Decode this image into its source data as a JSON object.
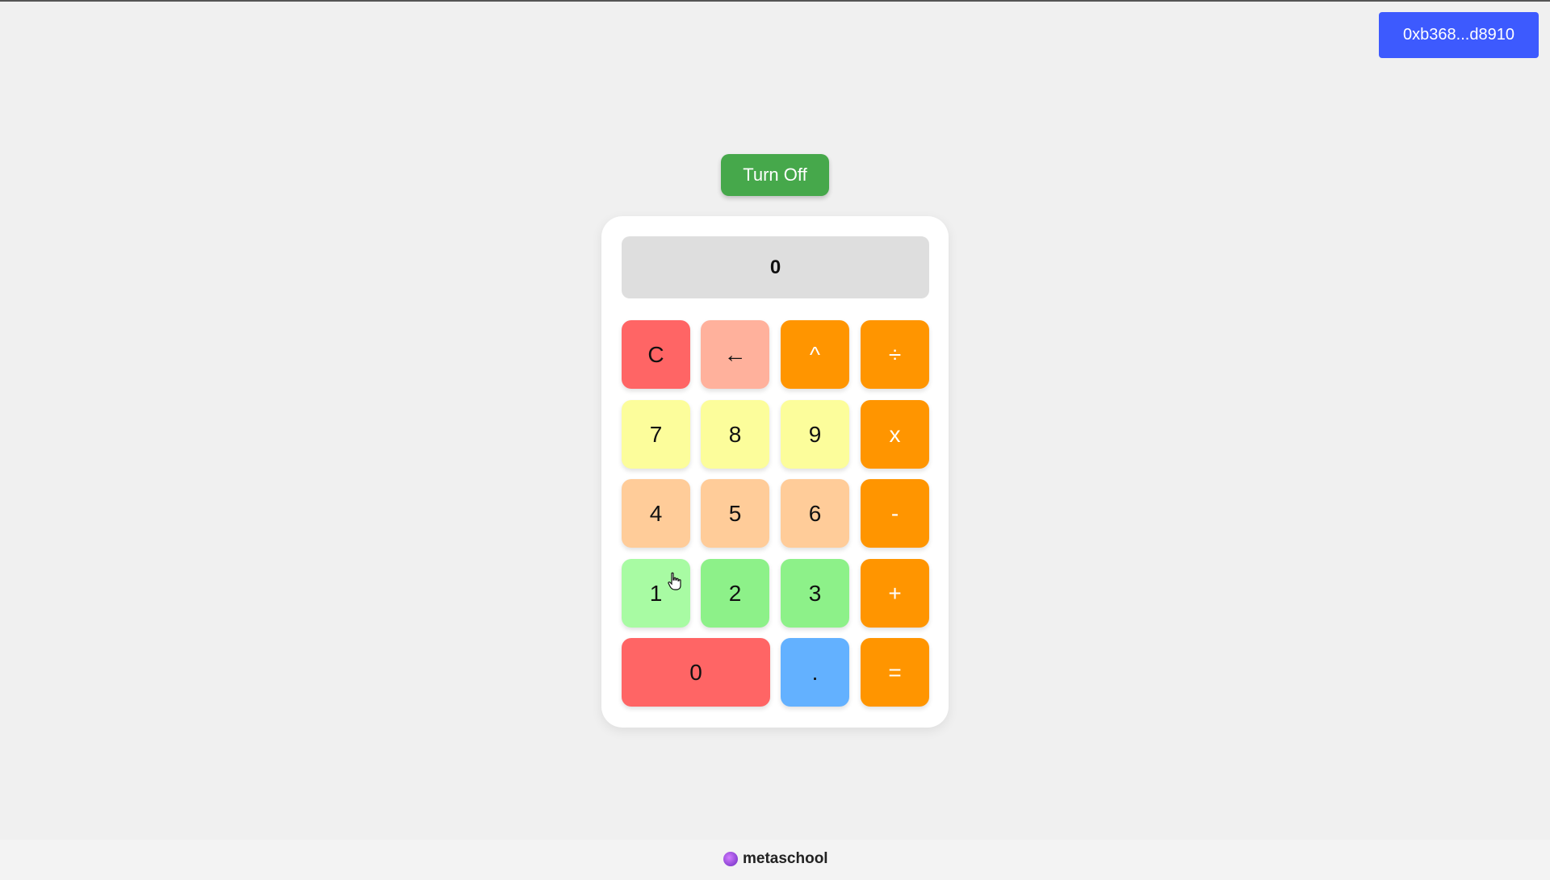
{
  "header": {
    "wallet_address": "0xb368...d8910"
  },
  "power_button_label": "Turn Off",
  "calculator": {
    "display_value": "0",
    "keys": {
      "clear": "C",
      "backspace": "←",
      "power": "^",
      "divide": "÷",
      "seven": "7",
      "eight": "8",
      "nine": "9",
      "multiply": "x",
      "four": "4",
      "five": "5",
      "six": "6",
      "subtract": "-",
      "one": "1",
      "two": "2",
      "three": "3",
      "add": "+",
      "zero": "0",
      "decimal": ".",
      "equals": "="
    }
  },
  "footer": {
    "brand": "metaschool"
  },
  "colors": {
    "wallet_blue": "#3d5afe",
    "power_green": "#46a84b",
    "operator_orange": "#ff9500",
    "clear_red": "#ff6565"
  },
  "icons": {
    "cursor": "hand-pointer-icon",
    "brand_logo": "metaschool-logo-icon"
  }
}
